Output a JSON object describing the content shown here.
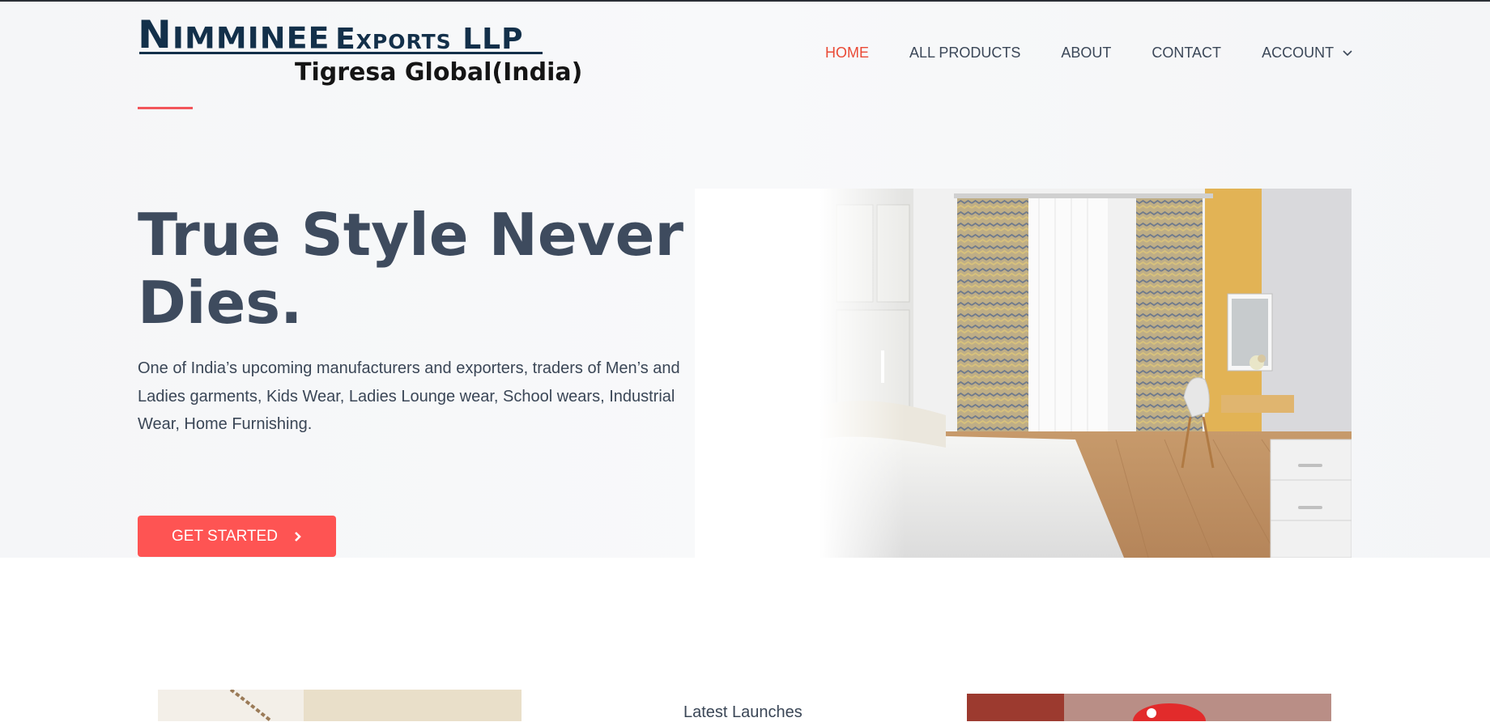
{
  "brand": {
    "line1_initial": "N",
    "line1_rest": "IMMINEE",
    "line1_suffix": "Exports LLP",
    "line2": "Tigresa Global(India)"
  },
  "nav": {
    "items": [
      {
        "label": "HOME",
        "active": true
      },
      {
        "label": "ALL PRODUCTS",
        "active": false
      },
      {
        "label": "ABOUT",
        "active": false
      },
      {
        "label": "CONTACT",
        "active": false
      },
      {
        "label": "ACCOUNT",
        "active": false,
        "has_dropdown": true
      }
    ]
  },
  "hero": {
    "title": "True Style Never Dies.",
    "description_lines": [
      "One of India’s upcoming manufacturers and exporters, traders of Men’s and",
      "Ladies garments, Kids Wear, Ladies Lounge wear, School wears, Industrial Wear, Home Furnishing."
    ],
    "cta_label": "GET STARTED",
    "cta_icon": "chevron-right-icon",
    "image_subject": "bedroom-interior"
  },
  "sections": {
    "latest_title": "Latest Launches"
  },
  "colors": {
    "accent": "#fe5453",
    "nav_active": "#ea4a36",
    "brand_navy": "#13304a",
    "text_dark": "#3e4b5e"
  }
}
